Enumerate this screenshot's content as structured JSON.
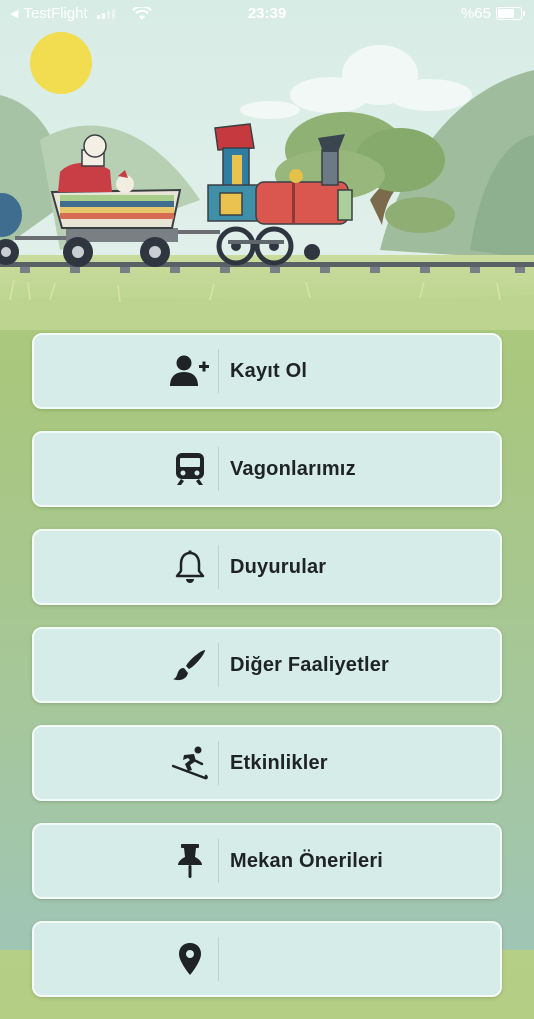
{
  "status_bar": {
    "back_app": "TestFlight",
    "time": "23:39",
    "battery": "%65"
  },
  "menu": [
    {
      "label": "Kayıt Ol",
      "icon": "user-plus-icon"
    },
    {
      "label": "Vagonlarımız",
      "icon": "train-icon"
    },
    {
      "label": "Duyurular",
      "icon": "bell-icon"
    },
    {
      "label": "Diğer Faaliyetler",
      "icon": "paint-brush-icon"
    },
    {
      "label": "Etkinlikler",
      "icon": "skiing-icon"
    },
    {
      "label": "Mekan Önerileri",
      "icon": "thumbtack-icon"
    },
    {
      "label": "",
      "icon": "map-marker-icon"
    }
  ],
  "colors": {
    "button_bg": "#d6ece8",
    "text": "#1f2326",
    "sky": "#d9ece6",
    "grass": "#b6cf86"
  }
}
